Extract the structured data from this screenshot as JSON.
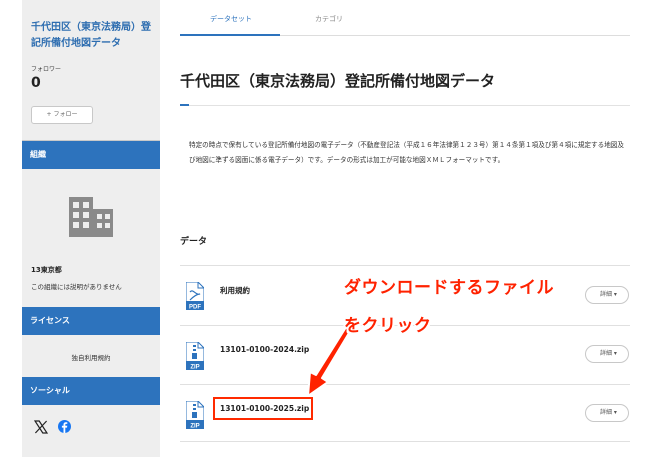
{
  "sidebar": {
    "dataset_title": "千代田区（東京法務局）登記所備付地図データ",
    "follower_label": "フォロワー",
    "follower_count": "0",
    "follow_button": "+ フォロー",
    "org_section": "組織",
    "org_name": "13東京都",
    "org_description": "この組織には説明がありません",
    "license_section": "ライセンス",
    "license_name": "独自利用規約",
    "social_section": "ソーシャル"
  },
  "tabs": [
    {
      "label": "データセット",
      "active": true
    },
    {
      "label": "カテゴリ",
      "active": false
    }
  ],
  "main": {
    "title": "千代田区（東京法務局）登記所備付地図データ",
    "description": "特定の時点で保有している登記所備付地図の電子データ（不動産登記法（平成１６年法律第１２３号）第１４条第１項及び第４項に規定する地図及び地図に準ずる図面に係る電子データ）です。データの形式は加工が可能な地図ＸＭＬフォーマットです。",
    "data_heading": "データ",
    "resources": [
      {
        "name": "利用規約",
        "format": "PDF",
        "icon": "pdf-file-icon",
        "button": "詳細"
      },
      {
        "name": "13101-0100-2024.zip",
        "format": "ZIP",
        "icon": "zip-file-icon",
        "button": "詳細"
      },
      {
        "name": "13101-0100-2025.zip",
        "format": "ZIP",
        "icon": "zip-file-icon",
        "button": "詳細"
      }
    ]
  },
  "annotation": {
    "line1": "ダウンロードするファイル",
    "line2": "をクリック",
    "color": "#ff2200"
  },
  "colors": {
    "accent": "#2d73bd",
    "sidebar_bg": "#eeeeee",
    "highlight": "#ff2a00"
  }
}
